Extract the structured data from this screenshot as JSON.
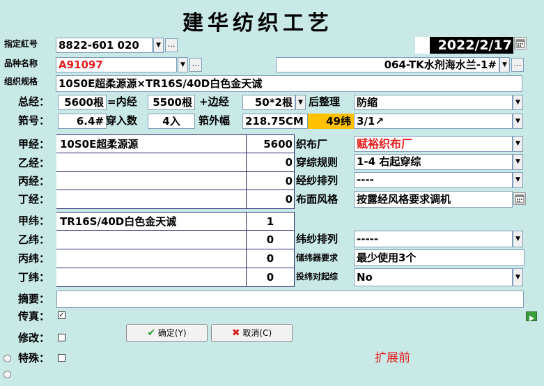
{
  "title": "建华纺织工艺",
  "labels": {
    "designated_number": "指定紅号",
    "variety_name": "品种名称",
    "weave_spec": "组织规格",
    "total_warp": "总经：",
    "reed_no": "筘号：",
    "eq_inner_warp": "=内经",
    "plus_edge_warp": "+边经",
    "post_finish": "后整理",
    "entering_count": "穿入数",
    "reed_outer_width": "筘外幅",
    "warp_a": "甲经：",
    "warp_b": "乙经：",
    "warp_c": "丙经：",
    "warp_d": "丁经：",
    "weft_a": "甲纬：",
    "weft_b": "乙纬：",
    "weft_c": "丙纬：",
    "weft_d": "丁纬：",
    "weaving_factory": "织布厂",
    "heald_rule": "穿综规则",
    "warp_arrangement": "经纱排列",
    "fabric_style": "布面风格",
    "weft_arrangement": "纬纱排列",
    "weft_storage_req": "储纬器要求",
    "pick_start": "投纬对起综",
    "summary": "摘要：",
    "fax": "传真：",
    "modify": "修改：",
    "special": "特殊："
  },
  "fields": {
    "designated_number": "8822-601 020",
    "date": "2022/2/17",
    "variety_name": "A91097",
    "variety_right": "064-TK水剂海水兰-1#",
    "weave_spec": "10S0E超柔源源×TR16S/40D白色金天诚",
    "total_warp": "5600根",
    "inner_warp": "5500根",
    "edge_warp": "50*2根",
    "post_finish": "防缩",
    "reed_no": "6.4#",
    "entering_count": "4入",
    "reed_outer_width": "218.75CM",
    "weft_count": "49纬",
    "weave_ratio": "3/1↗",
    "weaving_factory": "赋裕织布厂",
    "heald_rule": "1-4  右起穿综",
    "warp_arrangement": "----",
    "fabric_style": "按露经风格要求调机",
    "weft_arrangement": "-----",
    "weft_storage_req": "最少使用3个",
    "pick_start": "No",
    "summary": ""
  },
  "warp_rows": [
    {
      "name": "10S0E超柔源源",
      "count": "5600"
    },
    {
      "name": "",
      "count": "0"
    },
    {
      "name": "",
      "count": "0"
    },
    {
      "name": "",
      "count": "0"
    }
  ],
  "weft_rows": [
    {
      "name": "TR16S/40D白色金天诚",
      "count": "1"
    },
    {
      "name": "",
      "count": "0"
    },
    {
      "name": "",
      "count": "0"
    },
    {
      "name": "",
      "count": "0"
    }
  ],
  "checks": {
    "fax": true,
    "modify": false,
    "special": false
  },
  "buttons": {
    "ok": "确定(Y)",
    "cancel": "取消(C)"
  },
  "expand_text": "扩展前",
  "colors": {
    "background": "#c8e9e6",
    "highlight": "#ffc000",
    "red_text": "#e41e1e",
    "grid": "#2d2b74"
  }
}
